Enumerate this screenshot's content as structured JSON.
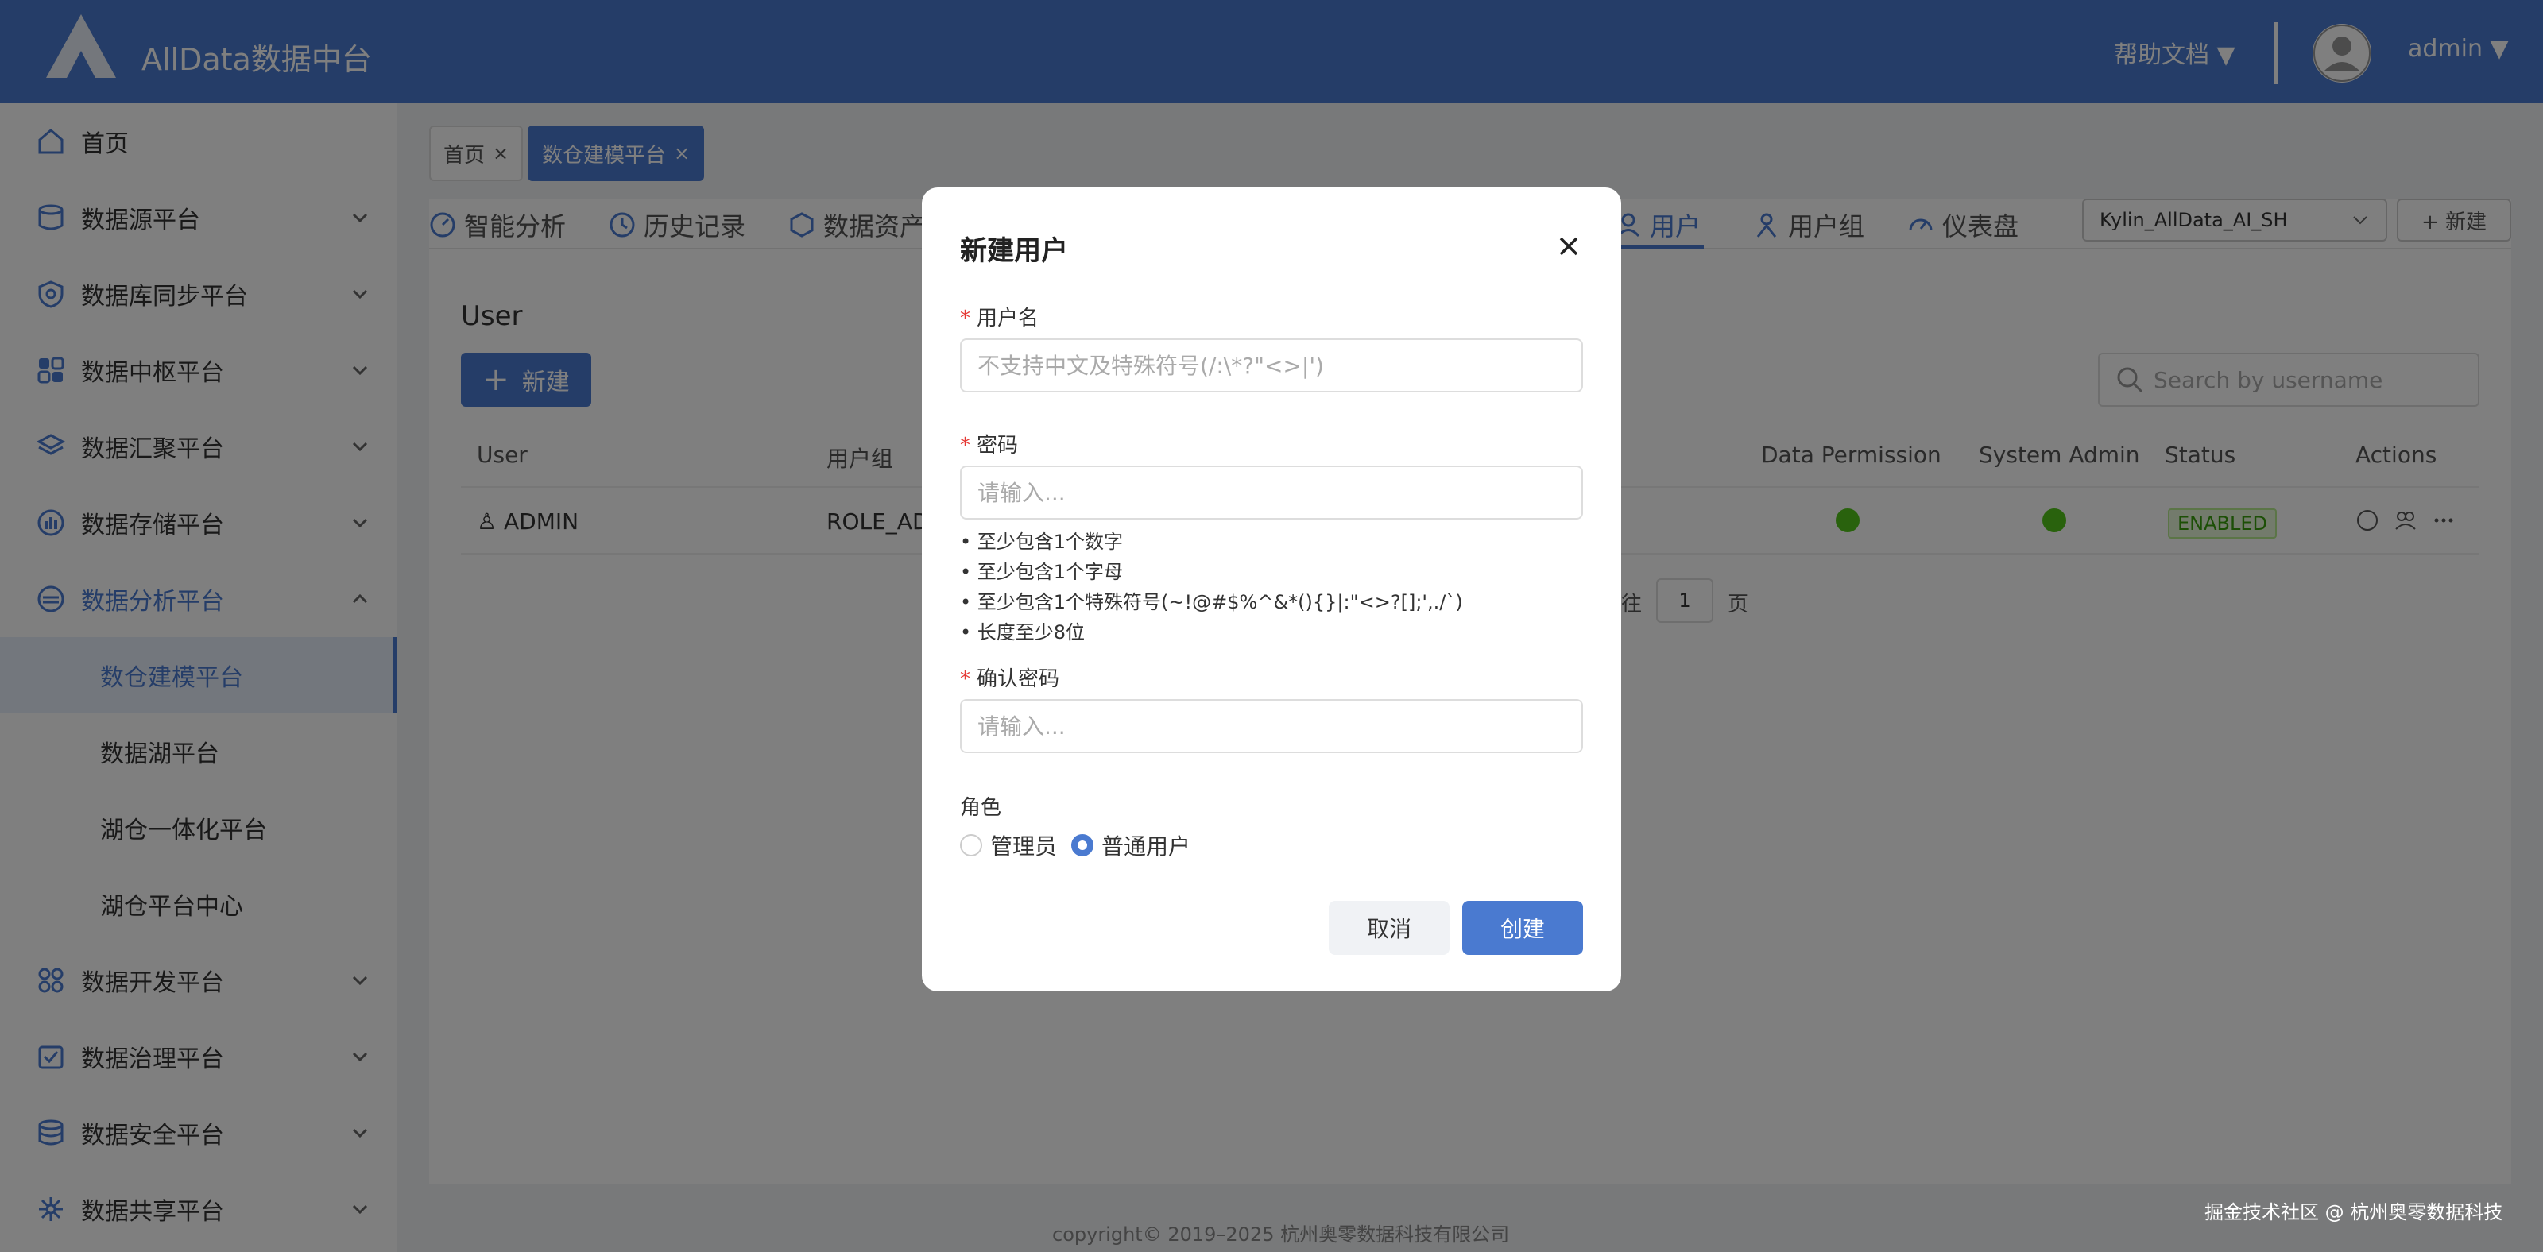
{
  "header": {
    "app_title": "AllData数据中台",
    "help_docs": "帮助文档 ▼",
    "user_name": "admin ▼"
  },
  "sidebar": {
    "items": [
      {
        "label": "首页",
        "icon": "home-icon"
      },
      {
        "label": "数据源平台",
        "icon": "database-icon"
      },
      {
        "label": "数据库同步平台",
        "icon": "sync-icon"
      },
      {
        "label": "数据中枢平台",
        "icon": "grid-icon"
      },
      {
        "label": "数据汇聚平台",
        "icon": "layers-icon"
      },
      {
        "label": "数据存储平台",
        "icon": "storage-icon"
      },
      {
        "label": "数据分析平台",
        "icon": "analysis-icon"
      },
      {
        "label": "数据开发平台",
        "icon": "dev-icon"
      },
      {
        "label": "数据治理平台",
        "icon": "governance-icon"
      },
      {
        "label": "数据安全平台",
        "icon": "security-icon"
      },
      {
        "label": "数据共享平台",
        "icon": "share-icon"
      }
    ],
    "sub_items": [
      {
        "label": "数仓建模平台"
      },
      {
        "label": "数据湖平台"
      },
      {
        "label": "湖仓一体化平台"
      },
      {
        "label": "湖仓平台中心"
      }
    ]
  },
  "tags": [
    {
      "label": "首页",
      "close": "×"
    },
    {
      "label": "数仓建模平台",
      "close": "×"
    }
  ],
  "nav_tabs": [
    {
      "label": "智能分析"
    },
    {
      "label": "历史记录"
    },
    {
      "label": "数据资产"
    },
    {
      "label": "用户"
    },
    {
      "label": "用户组"
    },
    {
      "label": "仪表盘"
    }
  ],
  "project_select": {
    "value": "Kylin_AllData_AI_SH"
  },
  "top_new_button": "+ 新建",
  "section_title": "User",
  "new_user_button": "新建",
  "search": {
    "placeholder": "Search by username"
  },
  "table": {
    "headers": [
      "User",
      "用户组",
      "Data Permission",
      "System Admin",
      "Status",
      "Actions"
    ],
    "rows": [
      {
        "user": "ADMIN",
        "group": "ROLE_AD",
        "status": "ENABLED"
      }
    ]
  },
  "pager": {
    "goto_label": "往",
    "page_value": "1",
    "page_label": "页"
  },
  "footer": {
    "copyright": "copyright© 2019–2025 杭州奥零数据科技有限公司",
    "watermark": "掘金技术社区 @ 杭州奥零数据科技"
  },
  "modal": {
    "title": "新建用户",
    "username_label": "用户名",
    "username_placeholder": "不支持中文及特殊符号(/:\\*?\"<>|')",
    "password_label": "密码",
    "password_placeholder": "请输入...",
    "password_hints": [
      "• 至少包含1个数字",
      "• 至少包含1个字母",
      "• 至少包含1个特殊符号(~!@#$%^&*(){}|:\"<>?[];',./`)",
      "• 长度至少8位"
    ],
    "confirm_label": "确认密码",
    "confirm_placeholder": "请输入...",
    "role_label": "角色",
    "roles": [
      {
        "label": "管理员",
        "checked": false
      },
      {
        "label": "普通用户",
        "checked": true
      }
    ],
    "cancel_button": "取消",
    "create_button": "创建"
  },
  "colors": {
    "primary": "#4a7ad0",
    "success": "#52c41a",
    "required": "#e53935"
  }
}
